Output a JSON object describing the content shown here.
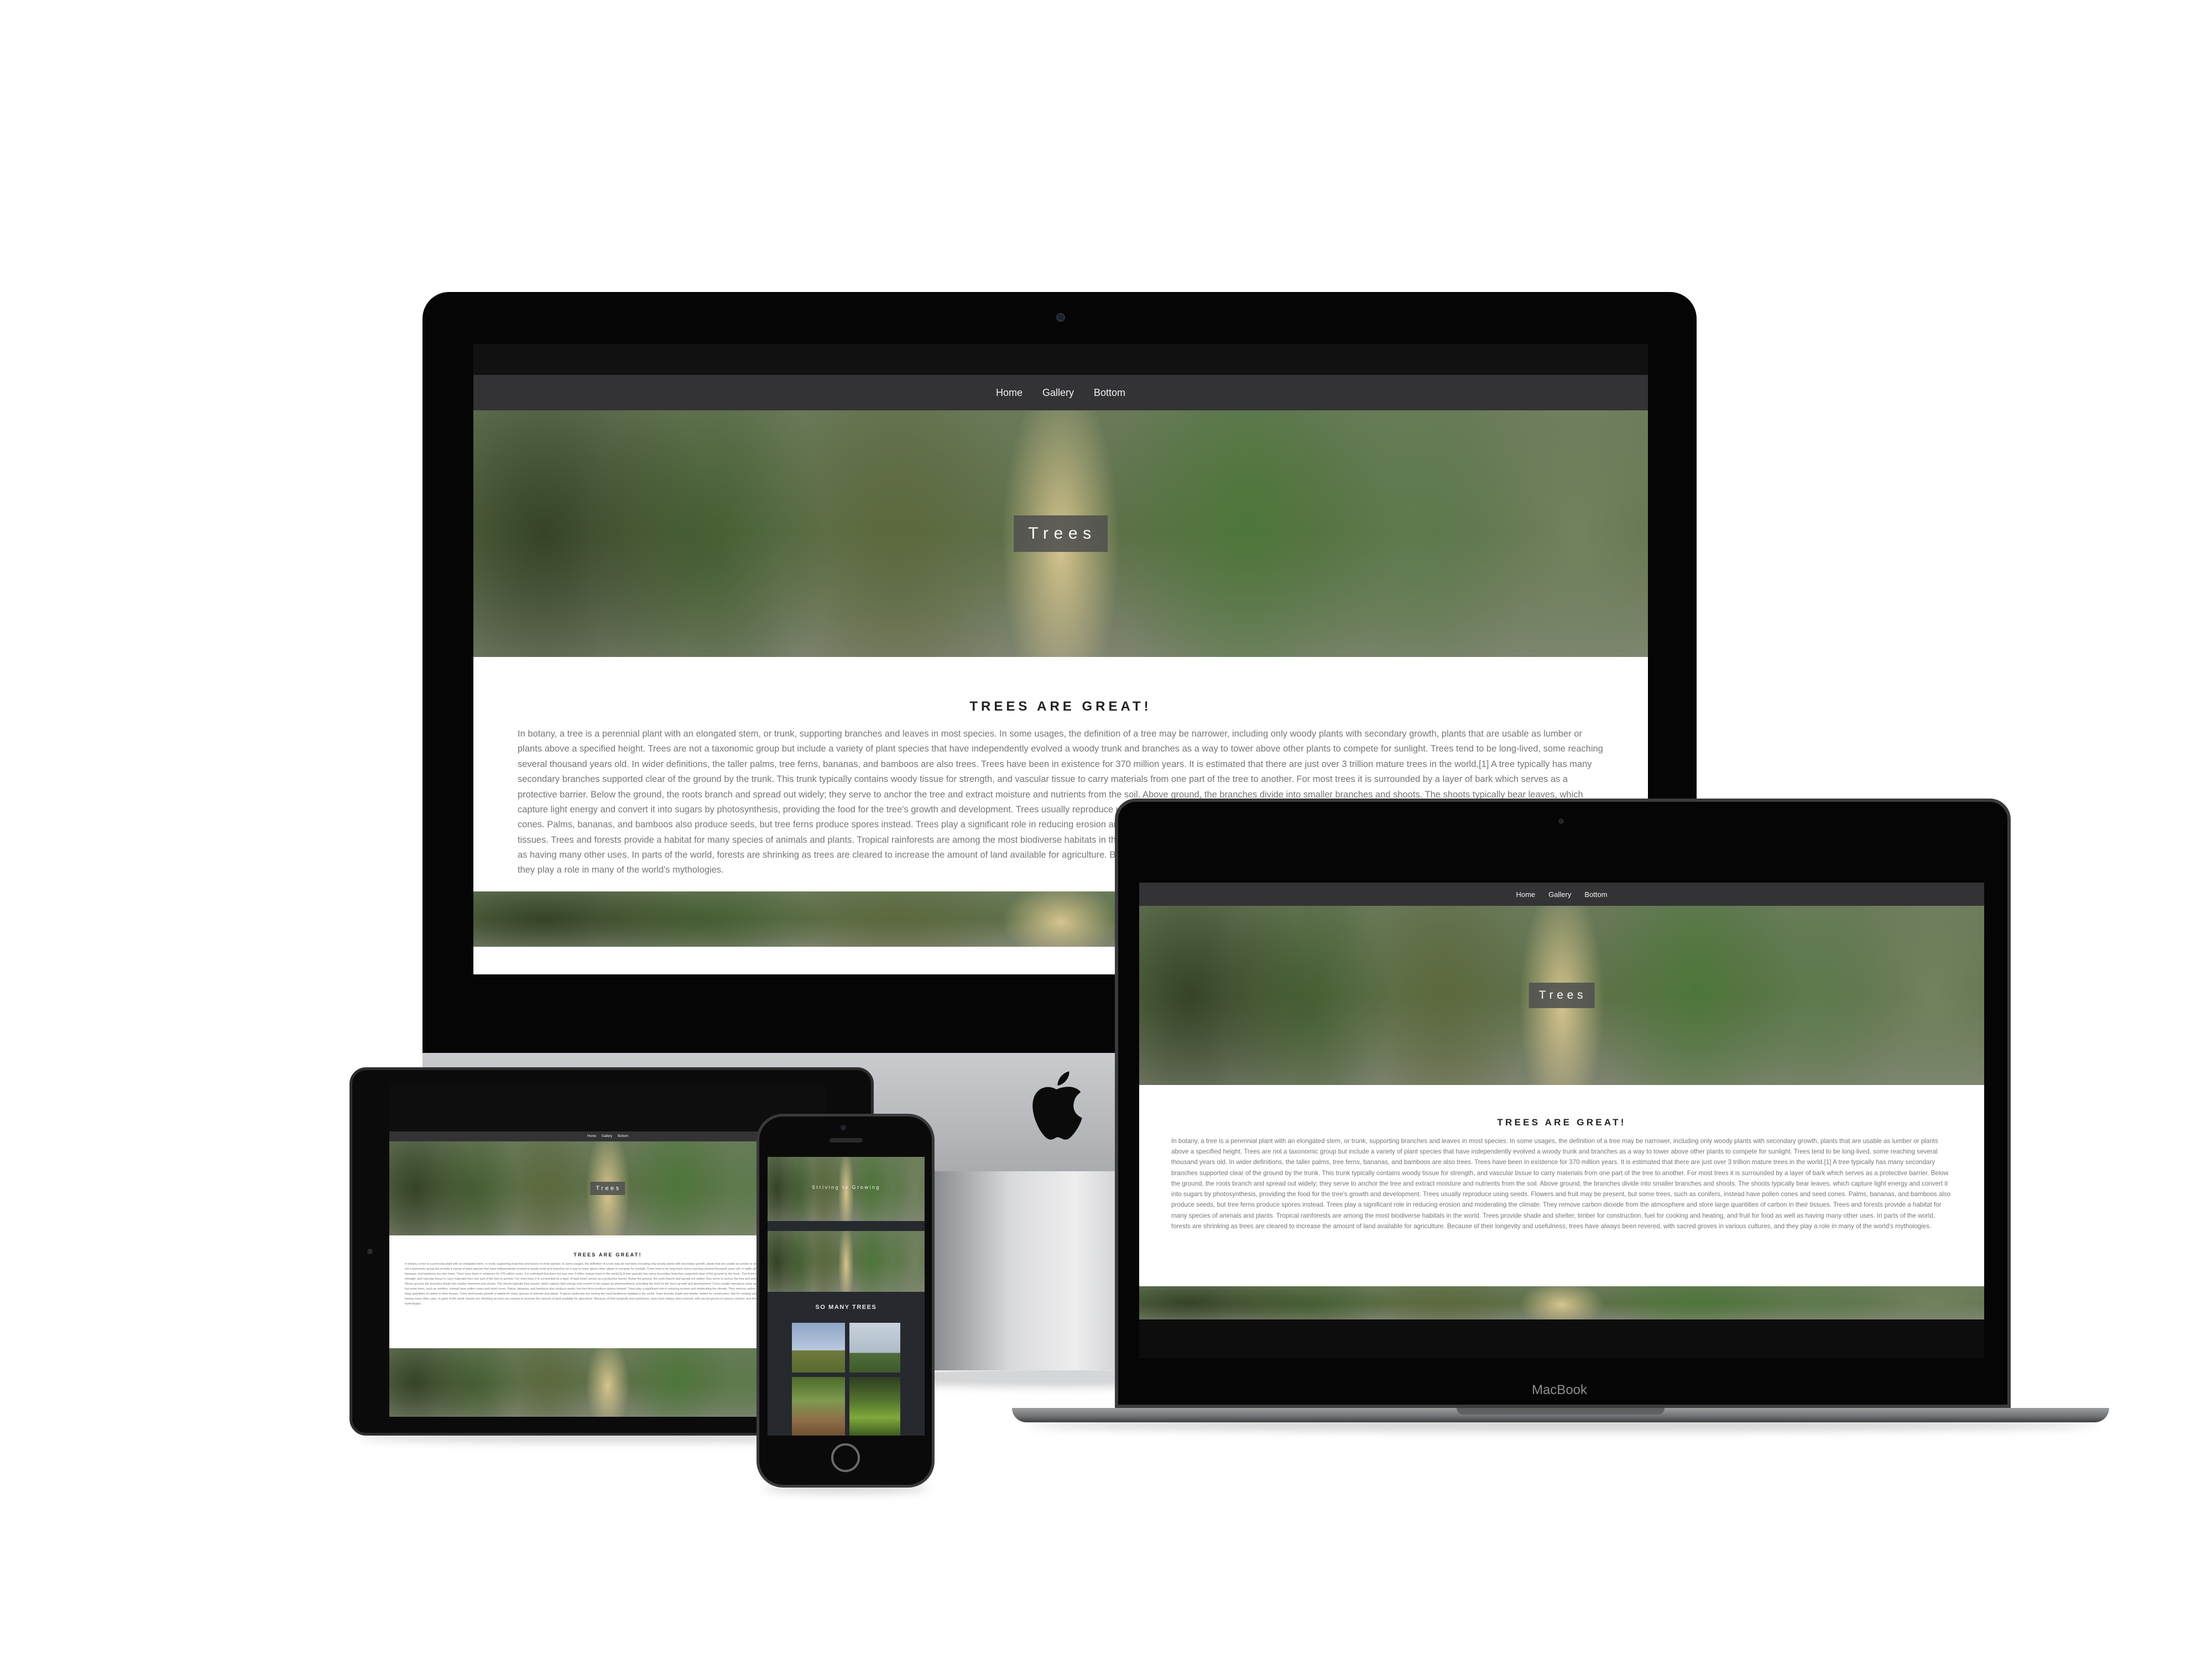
{
  "site": {
    "nav": [
      {
        "label": "Home"
      },
      {
        "label": "Gallery"
      },
      {
        "label": "Bottom"
      }
    ],
    "hero_title": "Trees",
    "section_heading": "TREES ARE GREAT!",
    "body_text": "In botany, a tree is a perennial plant with an elongated stem, or trunk, supporting branches and leaves in most species. In some usages, the definition of a tree may be narrower, including only woody plants with secondary growth, plants that are usable as lumber or plants above a specified height. Trees are not a taxonomic group but include a variety of plant species that have independently evolved a woody trunk and branches as a way to tower above other plants to compete for sunlight. Trees tend to be long-lived, some reaching several thousand years old. In wider definitions, the taller palms, tree ferns, bananas, and bamboos are also trees. Trees have been in existence for 370 million years. It is estimated that there are just over 3 trillion mature trees in the world.[1] A tree typically has many secondary branches supported clear of the ground by the trunk. This trunk typically contains woody tissue for strength, and vascular tissue to carry materials from one part of the tree to another. For most trees it is surrounded by a layer of bark which serves as a protective barrier. Below the ground, the roots branch and spread out widely; they serve to anchor the tree and extract moisture and nutrients from the soil. Above ground, the branches divide into smaller branches and shoots. The shoots typically bear leaves, which capture light energy and convert it into sugars by photosynthesis, providing the food for the tree's growth and development. Trees usually reproduce using seeds. Flowers and fruit may be present, but some trees, such as conifers, instead have pollen cones and seed cones. Palms, bananas, and bamboos also produce seeds, but tree ferns produce spores instead. Trees play a significant role in reducing erosion and moderating the climate. They remove carbon dioxide from the atmosphere and store large quantities of carbon in their tissues. Trees and forests provide a habitat for many species of animals and plants. Tropical rainforests are among the most biodiverse habitats in the world. Trees provide shade and shelter, timber for construction, fuel for cooking and heating, and fruit for food as well as having many other uses. In parts of the world, forests are shrinking as trees are cleared to increase the amount of land available for agriculture. Because of their longevity and usefulness, trees have always been revered, with sacred groves in various cultures, and they play a role in many of the world's mythologies."
  },
  "phone_site": {
    "hero_title": "Striving to Growing",
    "gallery_heading": "SO MANY TREES"
  },
  "devices": {
    "laptop_brand": "MacBook",
    "icons": [
      "apple-logo-icon",
      "camera-icon",
      "home-button-icon"
    ]
  },
  "colors": {
    "nav_bg": "#333335",
    "page_bg": "#ffffff",
    "hero_overlay": "#505050",
    "text_muted": "#777777",
    "phone_bg": "#26292e"
  }
}
